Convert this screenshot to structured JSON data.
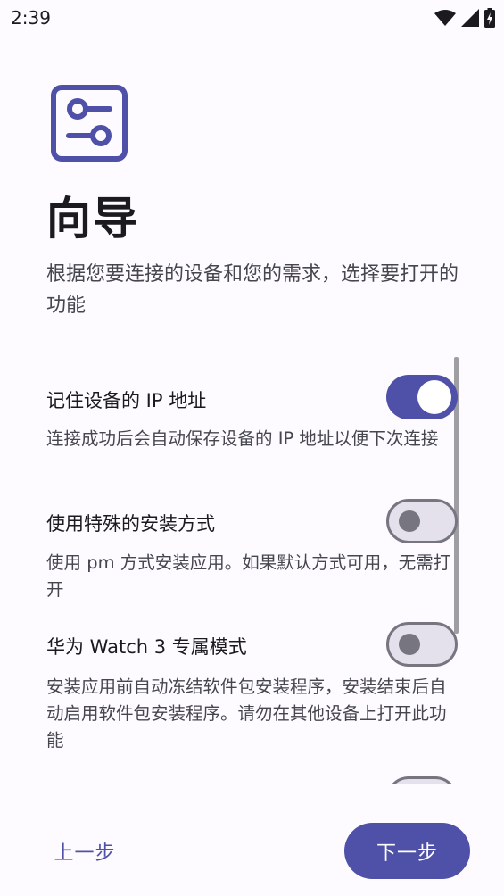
{
  "status_bar": {
    "time": "2:39",
    "icons": [
      "wifi-icon",
      "cellular-signal-icon",
      "battery-charging-icon"
    ]
  },
  "header": {
    "icon": "sliders-settings-icon",
    "title": "向导",
    "description": "根据您要连接的设备和您的需求，选择要打开的功能"
  },
  "settings": [
    {
      "title": "记住设备的 IP 地址",
      "description": "连接成功后会自动保存设备的 IP 地址以便下次连接",
      "enabled": true
    },
    {
      "title": "使用特殊的安装方式",
      "description": "使用 pm 方式安装应用。如果默认方式可用，无需打开",
      "enabled": false
    },
    {
      "title": "华为 Watch 3 专属模式",
      "description": "安装应用前自动冻结软件包安装程序，安装结束后自动启用软件包安装程序。请勿在其他设备上打开此功能",
      "enabled": false
    }
  ],
  "footer": {
    "prev_label": "上一步",
    "next_label": "下一步"
  },
  "colors": {
    "primary": "#4f51a8",
    "background": "#fdfbff",
    "switch_off_track": "#e4e1ec",
    "switch_off_outline": "#777680"
  }
}
